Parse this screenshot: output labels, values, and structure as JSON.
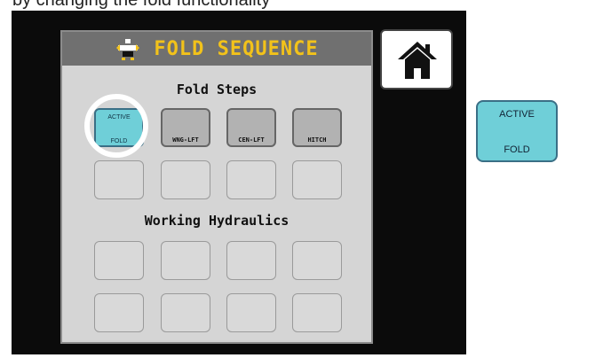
{
  "caption_fragment": "by changing the fold functionality",
  "header": {
    "title": "FOLD SEQUENCE",
    "icon": "fold-implement-icon"
  },
  "home": {
    "icon": "home-icon"
  },
  "fold_steps": {
    "title": "Fold Steps",
    "row1": [
      {
        "line1": "ACTIVE",
        "line2": "FOLD",
        "state": "active"
      },
      {
        "label": "WNG-LFT",
        "state": "assigned"
      },
      {
        "label": "CEN-LFT",
        "state": "assigned"
      },
      {
        "label": "HITCH",
        "state": "assigned"
      }
    ]
  },
  "working_hydraulics": {
    "title": "Working Hydraulics"
  },
  "callout": {
    "line1": "ACTIVE",
    "line2": "FOLD"
  },
  "colors": {
    "accent": "#f2c21a",
    "active": "#6fcfd8",
    "header": "#707070",
    "panel": "#d5d5d5"
  }
}
